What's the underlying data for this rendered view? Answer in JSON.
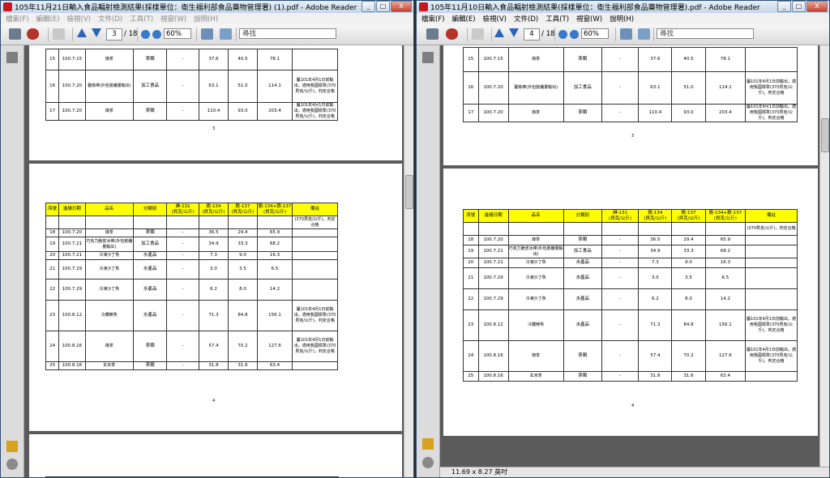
{
  "left": {
    "title": "105年11月21日輸入食品輻射檢測結果(採樣單位：衛生福利部食品藥物管理署) (1).pdf - Adobe Reader",
    "menus": [
      "檔案(F)",
      "編輯(E)",
      "檢視(V)",
      "文件(D)",
      "工具(T)",
      "視窗(W)",
      "說明(H)"
    ],
    "page_current": "3",
    "page_total": "/ 18",
    "zoom": "60%",
    "search_placeholder": "尋找",
    "page_labels": [
      "3",
      "4"
    ]
  },
  "right": {
    "title": "105年11月10日輸入食品輻射檢測結果(採樣單位：衛生福利部食品藥物管理署).pdf - Adobe Reader",
    "menus": [
      "檔案(F)",
      "編輯(E)",
      "檢視(V)",
      "文件(D)",
      "工具(T)",
      "視窗(W)",
      "說明(H)"
    ],
    "page_current": "4",
    "page_total": "/ 18",
    "zoom": "60%",
    "search_placeholder": "尋找",
    "status_size": "11.69 x 8.27 英吋",
    "page_labels": [
      "3",
      "4"
    ]
  },
  "window_buttons": {
    "minimize": "_",
    "restore": "□",
    "close": "X"
  },
  "headers": [
    "序號",
    "進樣日期",
    "品名",
    "分類別",
    "碘-131\n(貝克/公斤)",
    "銫-134\n(貝克/公斤)",
    "銫-137\n(貝克/公斤)",
    "銫-134+銫-137\n(貝克/公斤)",
    "備註"
  ],
  "note_full": "屬101年4月1日前輸出，適用我國標準(370貝克/公斤)，判定合格",
  "note_tail": "(370貝克/公斤)，判定合格",
  "rows_top": [
    {
      "no": "15",
      "date": "100.7.15",
      "name": "綠茶",
      "cat": "茶類",
      "i131": "-",
      "cs134": "37.6",
      "cs137": "40.5",
      "sum": "78.1",
      "note": ""
    },
    {
      "no": "16",
      "date": "100.7.20",
      "name": "薯條棒(外包裝纖量輸出)",
      "cat": "加工食品",
      "i131": "-",
      "cs134": "63.1",
      "cs137": "51.0",
      "sum": "114.1",
      "note": "屬101年4月1日前輸出，適用我國標準(370貝克/公斤)，判定合格"
    },
    {
      "no": "17",
      "date": "100.7.20",
      "name": "綠茶",
      "cat": "茶類",
      "i131": "-",
      "cs134": "110.4",
      "cs137": "93.0",
      "sum": "203.4",
      "note": "屬101年4月1日前輸出，適用我國標準(370貝克/公斤)，判定合格"
    }
  ],
  "rows_bottom": [
    {
      "no": "18",
      "date": "100.7.20",
      "name": "綠茶",
      "cat": "茶類",
      "i131": "-",
      "cs134": "36.5",
      "cs137": "29.4",
      "sum": "65.9",
      "note": ""
    },
    {
      "no": "19",
      "date": "100.7.21",
      "name": "巧克力脆皮冰棒(外包裝纖量輸出)",
      "cat": "加工食品",
      "i131": "-",
      "cs134": "34.9",
      "cs137": "33.3",
      "sum": "68.2",
      "note": ""
    },
    {
      "no": "20",
      "date": "100.7.21",
      "name": "冷凍沙丁魚",
      "cat": "水產品",
      "i131": "-",
      "cs134": "7.3",
      "cs137": "9.0",
      "sum": "16.3",
      "note": ""
    },
    {
      "no": "21",
      "date": "100.7.29",
      "name": "冷凍沙丁魚",
      "cat": "水產品",
      "i131": "-",
      "cs134": "3.0",
      "cs137": "3.5",
      "sum": "6.5",
      "note": ""
    },
    {
      "no": "22",
      "date": "100.7.29",
      "name": "冷凍沙丁魚",
      "cat": "水產品",
      "i131": "-",
      "cs134": "6.2",
      "cs137": "8.0",
      "sum": "14.2",
      "note": ""
    },
    {
      "no": "23",
      "date": "100.8.12",
      "name": "冷藏鯡魚",
      "cat": "水產品",
      "i131": "-",
      "cs134": "71.3",
      "cs137": "84.8",
      "sum": "156.1",
      "note": "屬101年4月1日前輸出，適用我國標準(370貝克/公斤)，判定合格"
    },
    {
      "no": "24",
      "date": "100.8.16",
      "name": "綠茶",
      "cat": "茶類",
      "i131": "-",
      "cs134": "57.4",
      "cs137": "70.2",
      "sum": "127.6",
      "note": "屬101年4月1日前輸出，適用我國標準(370貝克/公斤)，判定合格"
    },
    {
      "no": "25",
      "date": "100.8.16",
      "name": "玄米茶",
      "cat": "茶類",
      "i131": "-",
      "cs134": "31.8",
      "cs137": "31.6",
      "sum": "63.4",
      "note": ""
    }
  ],
  "colors": {
    "header_yellow": "#ffff00",
    "doc_bg": "#5b5b5b",
    "title_gradient": "#c5d6ea"
  }
}
